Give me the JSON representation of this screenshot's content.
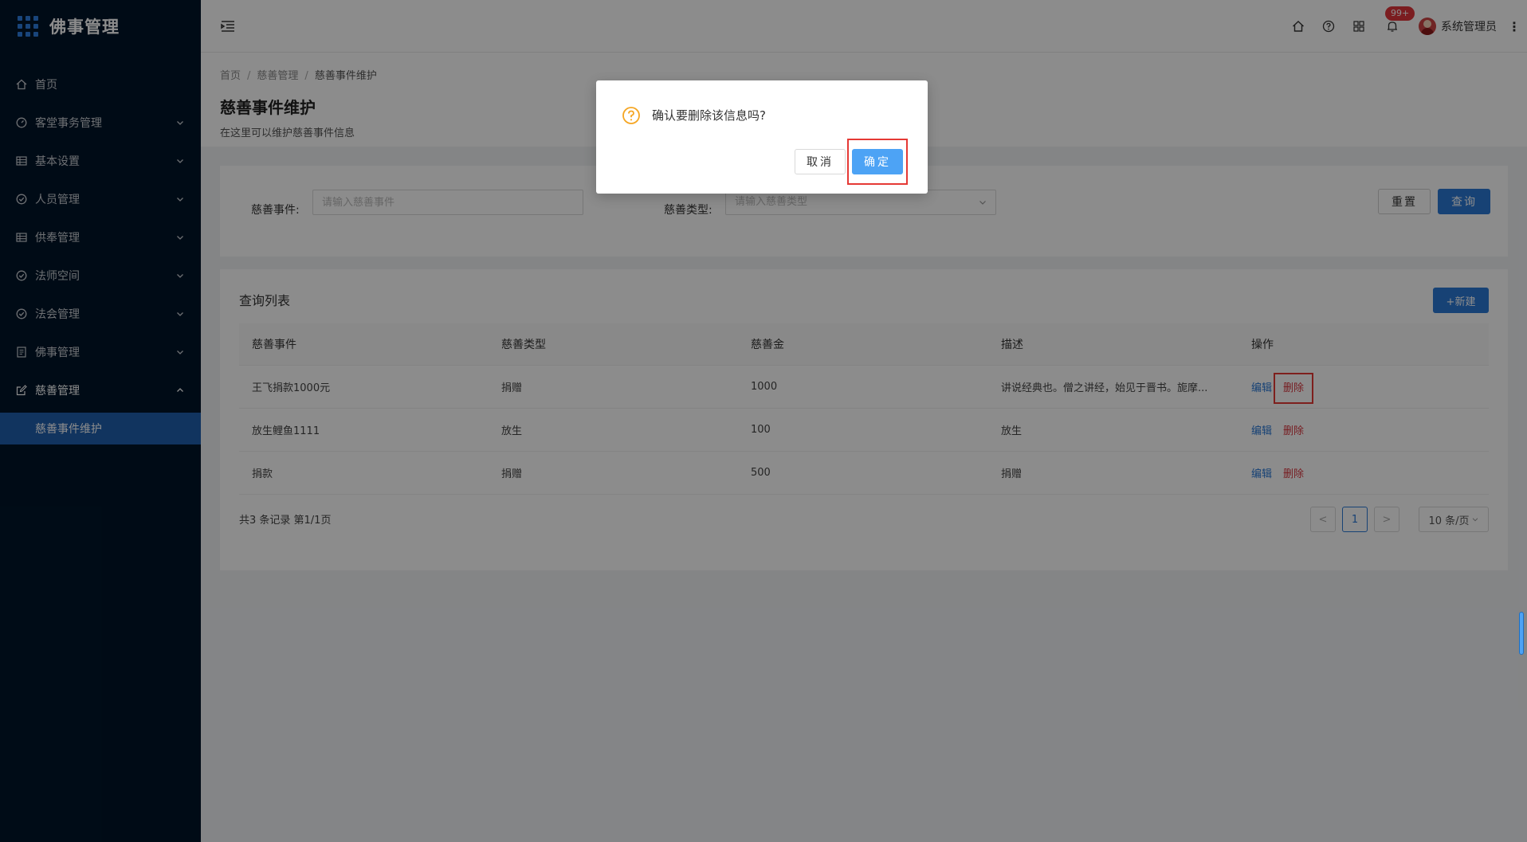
{
  "app": {
    "title": "佛事管理"
  },
  "sidebar": {
    "items": [
      {
        "label": "首页",
        "icon": "home-icon"
      },
      {
        "label": "客堂事务管理",
        "icon": "dashboard-icon"
      },
      {
        "label": "基本设置",
        "icon": "table-icon"
      },
      {
        "label": "人员管理",
        "icon": "check-circle-icon"
      },
      {
        "label": "供奉管理",
        "icon": "table-icon"
      },
      {
        "label": "法师空间",
        "icon": "check-circle-icon"
      },
      {
        "label": "法会管理",
        "icon": "check-circle-icon"
      },
      {
        "label": "佛事管理",
        "icon": "file-icon"
      },
      {
        "label": "慈善管理",
        "icon": "edit-icon"
      }
    ],
    "active_sub": "慈善事件维护"
  },
  "header": {
    "notification_badge": "99+",
    "user_name": "系统管理员",
    "more": "⋮"
  },
  "breadcrumb": {
    "items": [
      "首页",
      "慈善管理",
      "慈善事件维护"
    ],
    "sep": "/"
  },
  "page": {
    "title": "慈善事件维护",
    "desc": "在这里可以维护慈善事件信息"
  },
  "search": {
    "event_label": "慈善事件:",
    "event_placeholder": "请输入慈善事件",
    "type_label": "慈善类型:",
    "type_placeholder": "请输入慈善类型",
    "reset": "重置",
    "query": "查询"
  },
  "list": {
    "title": "查询列表",
    "new_button": "+新建",
    "columns": [
      "慈善事件",
      "慈善类型",
      "慈善金",
      "描述",
      "操作"
    ],
    "rows": [
      {
        "event": "王飞捐款1000元",
        "type": "捐赠",
        "amount": "1000",
        "desc": "讲说经典也。僧之讲经，始见于晋书。旎摩...",
        "edit": "编辑",
        "del": "删除"
      },
      {
        "event": "放生鲤鱼1111",
        "type": "放生",
        "amount": "100",
        "desc": "放生",
        "edit": "编辑",
        "del": "删除"
      },
      {
        "event": "捐款",
        "type": "捐赠",
        "amount": "500",
        "desc": "捐赠",
        "edit": "编辑",
        "del": "删除"
      }
    ],
    "total": "共3 条记录 第1/1页",
    "pager": {
      "prev": "<",
      "current": "1",
      "next": ">",
      "size": "10 条/页"
    }
  },
  "modal": {
    "message": "确认要删除该信息吗?",
    "cancel": "取消",
    "ok": "确定"
  },
  "colors": {
    "primary": "#2a78d6",
    "danger": "#d9363e",
    "sidebar_bg": "#001529",
    "warning": "#f5a623",
    "highlight": "#e53935"
  }
}
